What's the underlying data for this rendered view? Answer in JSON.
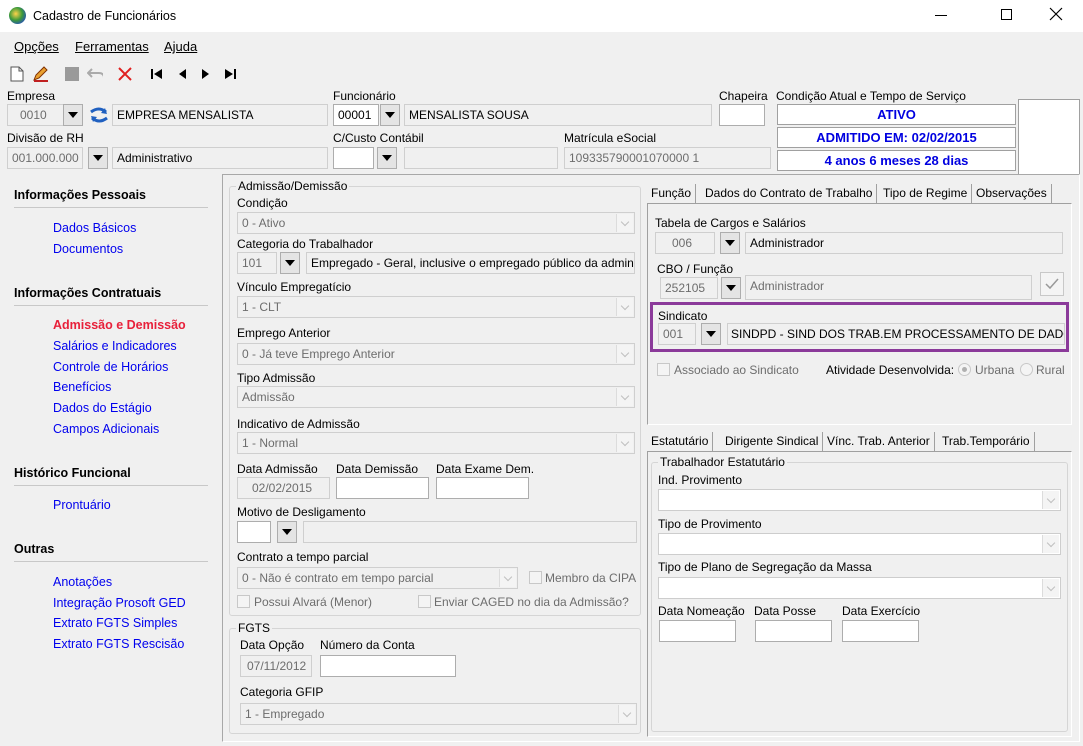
{
  "window": {
    "title": "Cadastro de Funcionários"
  },
  "menu": {
    "opcoes": "Opções",
    "ferramentas": "Ferramentas",
    "ajuda": "Ajuda"
  },
  "header": {
    "empresa_label": "Empresa",
    "empresa_code": "0010",
    "empresa_name": "EMPRESA MENSALISTA",
    "funcionario_label": "Funcionário",
    "funcionario_code": "00001",
    "funcionario_name": "MENSALISTA SOUSA",
    "chapeira_label": "Chapeira",
    "chapeira_value": "",
    "condicao_label": "Condição Atual e Tempo de Serviço",
    "status_ativo": "ATIVO",
    "status_admitido": "ADMITIDO EM: 02/02/2015",
    "status_tempo": "4 anos 6 meses 28 dias",
    "divisao_label": "Divisão de RH",
    "divisao_code": "001.000.000",
    "divisao_name": "Administrativo",
    "ccusto_label": "C/Custo Contábil",
    "ccusto_code": "",
    "ccusto_name": "",
    "matricula_label": "Matrícula eSocial",
    "matricula_value": "109335790001070000 1"
  },
  "sidebar": {
    "sec1": "Informações Pessoais",
    "dados_basicos": "Dados Básicos",
    "documentos": "Documentos",
    "sec2": "Informações Contratuais",
    "admissao": "Admissão e Demissão",
    "salarios": "Salários e Indicadores",
    "controle": "Controle de Horários",
    "beneficios": "Benefícios",
    "estagio": "Dados do Estágio",
    "campos": "Campos Adicionais",
    "sec3": "Histórico Funcional",
    "prontuario": "Prontuário",
    "sec4": "Outras",
    "anotacoes": "Anotações",
    "integracao": "Integração Prosoft GED",
    "extrato_simples": "Extrato FGTS Simples",
    "extrato_rescisao": "Extrato FGTS Rescisão"
  },
  "admissao": {
    "group": "Admissão/Demissão",
    "condicao_label": "Condição",
    "condicao_value": "0 - Ativo",
    "categoria_label": "Categoria do Trabalhador",
    "categoria_code": "101",
    "categoria_desc": "Empregado - Geral, inclusive o empregado público da administ",
    "vinculo_label": "Vínculo Empregatício",
    "vinculo_value": "1 - CLT",
    "emprego_label": "Emprego Anterior",
    "emprego_value": "0 - Já teve Emprego Anterior",
    "tipo_label": "Tipo Admissão",
    "tipo_value": "Admissão",
    "indicativo_label": "Indicativo de Admissão",
    "indicativo_value": "1 - Normal",
    "data_adm_label": "Data Admissão",
    "data_adm_value": "02/02/2015",
    "data_dem_label": "Data Demissão",
    "data_dem_value": "",
    "data_exame_label": "Data Exame Dem.",
    "data_exame_value": "",
    "motivo_label": "Motivo de Desligamento",
    "contrato_label": "Contrato a tempo parcial",
    "contrato_value": "0 - Não é contrato em tempo parcial",
    "membro_cipa": "Membro da CIPA",
    "alvara": "Possui Alvará (Menor)",
    "caged": "Enviar CAGED no dia da Admissão?"
  },
  "fgts": {
    "group": "FGTS",
    "data_opcao_label": "Data Opção",
    "data_opcao_value": "07/11/2012",
    "conta_label": "Número da Conta",
    "conta_value": "",
    "categoria_label": "Categoria GFIP",
    "categoria_value": "1 - Empregado"
  },
  "tabs_top": [
    "Função",
    "Dados do Contrato de Trabalho",
    "Tipo de Regime",
    "Observações"
  ],
  "funcao": {
    "tabela_label": "Tabela de Cargos e Salários",
    "tabela_code": "006",
    "tabela_name": "Administrador",
    "cbo_label": "CBO / Função",
    "cbo_code": "252105",
    "cbo_name": "Administrador",
    "sindicato_label": "Sindicato",
    "sindicato_code": "001",
    "sindicato_name": "SINDPD - SIND DOS TRAB.EM PROCESSAMENTO DE DADOS ES",
    "associado": "Associado ao Sindicato",
    "atividade_label": "Atividade Desenvolvida:",
    "urbana": "Urbana",
    "rural": "Rural"
  },
  "tabs_bottom": [
    "Estatutário",
    "Dirigente Sindical",
    "Vínc. Trab. Anterior",
    "Trab.Temporário"
  ],
  "estatutario": {
    "group": "Trabalhador Estatutário",
    "ind_label": "Ind. Provimento",
    "tipo_label": "Tipo de Provimento",
    "plano_label": "Tipo de Plano de Segregação da Massa",
    "nomeacao_label": "Data Nomeação",
    "posse_label": "Data Posse",
    "exercicio_label": "Data Exercício"
  },
  "colors": {
    "link": "#0000ee",
    "active": "#e8203a",
    "highlight": "#8b3a9a"
  }
}
